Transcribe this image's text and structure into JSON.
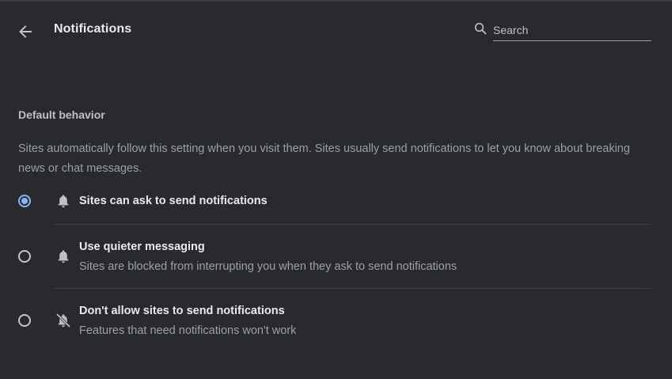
{
  "header": {
    "title": "Notifications",
    "back_icon": "back-arrow-icon",
    "search": {
      "placeholder": "Search",
      "value": "",
      "icon": "search-icon"
    }
  },
  "section": {
    "heading": "Default behavior",
    "description": "Sites automatically follow this setting when you visit them. Sites usually send notifications to let you know about breaking news or chat messages."
  },
  "options": [
    {
      "label": "Sites can ask to send notifications",
      "sublabel": "",
      "icon": "bell-icon",
      "selected": true
    },
    {
      "label": "Use quieter messaging",
      "sublabel": "Sites are blocked from interrupting you when they ask to send notifications",
      "icon": "bell-icon",
      "selected": false
    },
    {
      "label": "Don't allow sites to send notifications",
      "sublabel": "Features that need notifications won't work",
      "icon": "bell-off-icon",
      "selected": false
    }
  ],
  "colors": {
    "background": "#292a2d",
    "accent": "#8ab4f8",
    "primary_text": "#e8eaed",
    "secondary_text": "#9aa0a6"
  }
}
